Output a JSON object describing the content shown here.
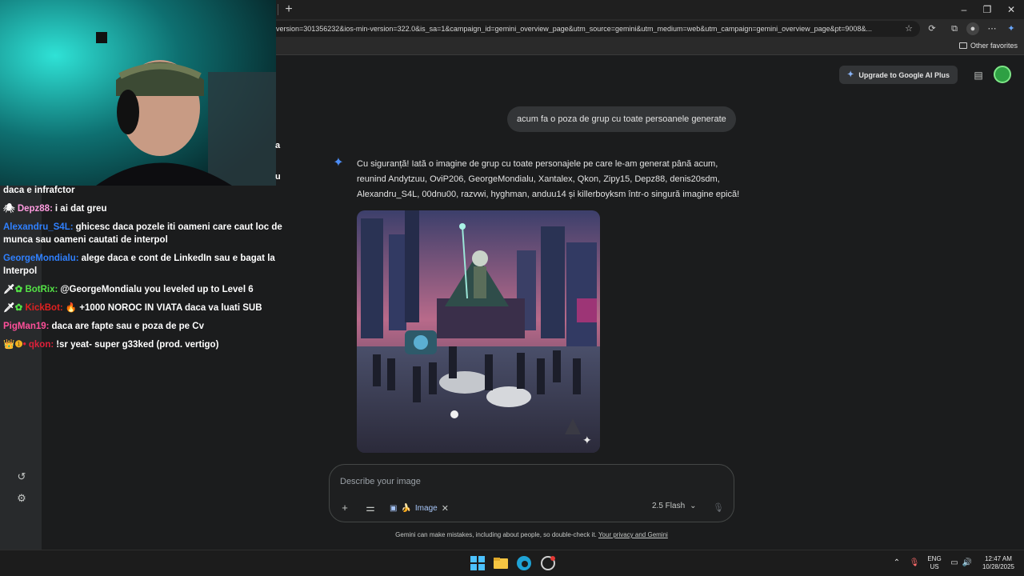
{
  "browser": {
    "url": "version=301356232&ios-min-version=322.0&is_sa=1&campaign_id=gemini_overview_page&utm_source=gemini&utm_medium=web&utm_campaign=gemini_overview_page&pt=9008&...",
    "other_favorites": "Other favorites",
    "new_tab": "+",
    "minimize": "–",
    "restore": "❐",
    "close": "✕"
  },
  "header": {
    "upgrade_label": "Upgrade to Google AI Plus"
  },
  "conversation": {
    "user_prompt": "acum fa o poza de grup cu toate persoanele generate",
    "answer": "Cu siguranță! Iată o imagine de grup cu toate personajele pe care le-am generat până acum, reunind Andytzuu, OviP206, GeorgeMondialu, Xantalex, Qkon, Zipy15, Depz88, denis20sdm, Alexandru_S4L, 00dnu00, razvwi, hyghman, anduu14 și killerboyksm într-o singură imagine epică!"
  },
  "composer": {
    "placeholder": "Describe your image",
    "chip_label": "Image",
    "model": "2.5 Flash"
  },
  "footer": {
    "disclaimer": "Gemini can make mistakes, including about people, so double-check it.",
    "privacy_link": "Your privacy and Gemini"
  },
  "chat": {
    "partial_top": "a",
    "partial_mid": "u",
    "lines": [
      {
        "user": "",
        "text": "daca e infrafctor",
        "color": "#ffffff"
      },
      {
        "user": "Depz88:",
        "text": "i ai dat greu",
        "color": "#ff9ce0"
      },
      {
        "user": "Alexandru_S4L:",
        "text": "ghicesc daca pozele iti oameni care caut loc de munca sau oameni cautati de interpol",
        "color": "#2f80ff"
      },
      {
        "user": "GeorgeMondialu:",
        "text": "alege daca e cont de LinkedIn sau e bagat la Interpol",
        "color": "#2f80ff"
      },
      {
        "user": "BotRix:",
        "text": "@GeorgeMondialu you leveled up to Level 6",
        "color": "#54e346"
      },
      {
        "user": "KickBot:",
        "text": "+1000 NOROC IN VIATA daca va luati SUB",
        "color": "#e02020"
      },
      {
        "user": "PigMan19:",
        "text": "daca are fapte sau e poza de pe Cv",
        "color": "#ff4f9a"
      },
      {
        "user": "qkon:",
        "text": "!sr yeat- super g33ked (prod. vertigo)",
        "color": "#e0203a"
      }
    ]
  },
  "taskbar": {
    "lang_top": "ENG",
    "lang_bottom": "US",
    "time": "12:47 AM",
    "date": "10/28/2025"
  },
  "colors": {
    "accent": "#4c8df6",
    "background": "#1b1c1d",
    "bubble": "#333537"
  }
}
